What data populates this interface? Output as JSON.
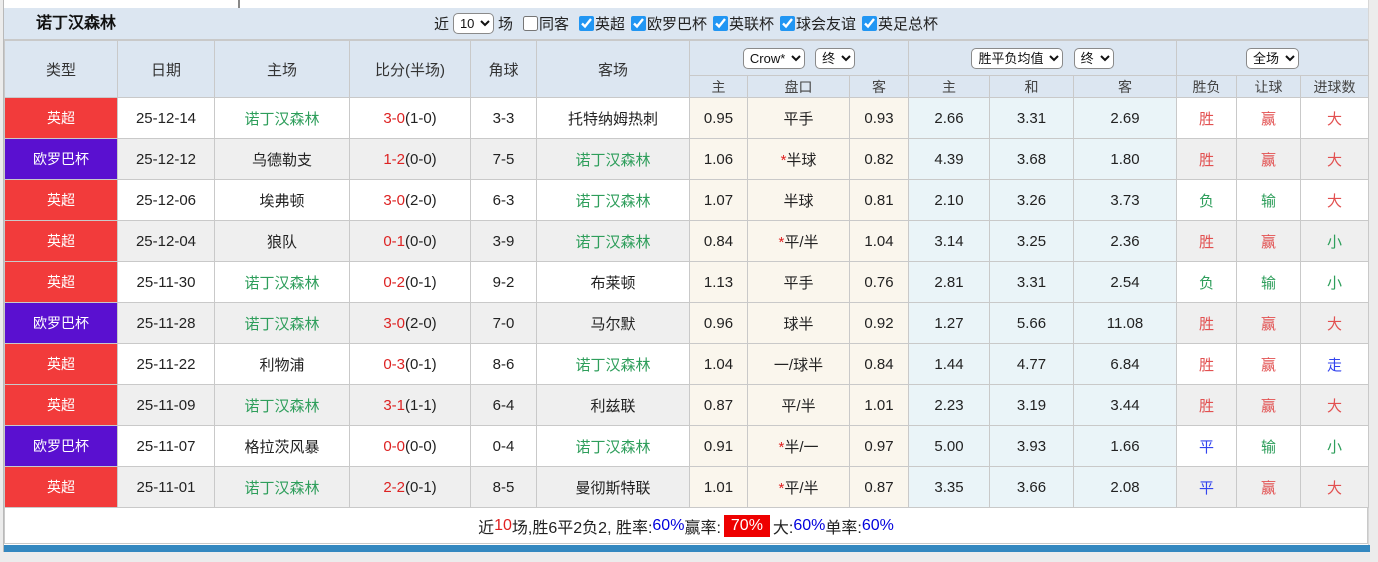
{
  "page": {
    "title": "诺丁汉森林",
    "filter": {
      "recent_prefix": "近",
      "recent_value": "10",
      "recent_suffix": "场",
      "same_away_label": "同客",
      "same_away_checked": false,
      "leagues": [
        {
          "label": "英超",
          "checked": true
        },
        {
          "label": "欧罗巴杯",
          "checked": true
        },
        {
          "label": "英联杯",
          "checked": true
        },
        {
          "label": "球会友谊",
          "checked": true
        },
        {
          "label": "英足总杯",
          "checked": true
        }
      ]
    }
  },
  "table": {
    "columns": [
      "类型",
      "日期",
      "主场",
      "比分(半场)",
      "角球",
      "客场"
    ],
    "groups": {
      "handicap": {
        "company_select": "Crow*",
        "time_select": "终",
        "sub": [
          "主",
          "盘口",
          "客"
        ]
      },
      "europe": {
        "company_select": "胜平负均值",
        "time_select": "终",
        "sub": [
          "主",
          "和",
          "客"
        ]
      },
      "result": {
        "scope_select": "全场",
        "sub": [
          "胜负",
          "让球",
          "进球数"
        ]
      }
    },
    "rows": [
      {
        "league": "英超",
        "league_color": "red",
        "date": "25-12-14",
        "home": "诺丁汉森林",
        "home_self": true,
        "score": "3-0",
        "half": "(1-0)",
        "corner": "3-3",
        "away": "托特纳姆热刺",
        "away_self": false,
        "hcap_home": "0.95",
        "hcap_star": false,
        "hcap_line": "平手",
        "hcap_away": "0.93",
        "euro": [
          "2.66",
          "3.31",
          "2.69"
        ],
        "results": [
          [
            "胜",
            "red"
          ],
          [
            "赢",
            "red"
          ],
          [
            "大",
            "red"
          ]
        ]
      },
      {
        "league": "欧罗巴杯",
        "league_color": "purple",
        "date": "25-12-12",
        "home": "乌德勒支",
        "home_self": false,
        "score": "1-2",
        "half": "(0-0)",
        "corner": "7-5",
        "away": "诺丁汉森林",
        "away_self": true,
        "hcap_home": "1.06",
        "hcap_star": true,
        "hcap_line": "半球",
        "hcap_away": "0.82",
        "euro": [
          "4.39",
          "3.68",
          "1.80"
        ],
        "results": [
          [
            "胜",
            "red"
          ],
          [
            "赢",
            "red"
          ],
          [
            "大",
            "red"
          ]
        ]
      },
      {
        "league": "英超",
        "league_color": "red",
        "date": "25-12-06",
        "home": "埃弗顿",
        "home_self": false,
        "score": "3-0",
        "half": "(2-0)",
        "corner": "6-3",
        "away": "诺丁汉森林",
        "away_self": true,
        "hcap_home": "1.07",
        "hcap_star": false,
        "hcap_line": "半球",
        "hcap_away": "0.81",
        "euro": [
          "2.10",
          "3.26",
          "3.73"
        ],
        "results": [
          [
            "负",
            "green"
          ],
          [
            "输",
            "green"
          ],
          [
            "大",
            "red"
          ]
        ]
      },
      {
        "league": "英超",
        "league_color": "red",
        "date": "25-12-04",
        "home": "狼队",
        "home_self": false,
        "score": "0-1",
        "half": "(0-0)",
        "corner": "3-9",
        "away": "诺丁汉森林",
        "away_self": true,
        "hcap_home": "0.84",
        "hcap_star": true,
        "hcap_line": "平/半",
        "hcap_away": "1.04",
        "euro": [
          "3.14",
          "3.25",
          "2.36"
        ],
        "results": [
          [
            "胜",
            "red"
          ],
          [
            "赢",
            "red"
          ],
          [
            "小",
            "green"
          ]
        ]
      },
      {
        "league": "英超",
        "league_color": "red",
        "date": "25-11-30",
        "home": "诺丁汉森林",
        "home_self": true,
        "score": "0-2",
        "half": "(0-1)",
        "corner": "9-2",
        "away": "布莱顿",
        "away_self": false,
        "hcap_home": "1.13",
        "hcap_star": false,
        "hcap_line": "平手",
        "hcap_away": "0.76",
        "euro": [
          "2.81",
          "3.31",
          "2.54"
        ],
        "results": [
          [
            "负",
            "green"
          ],
          [
            "输",
            "green"
          ],
          [
            "小",
            "green"
          ]
        ]
      },
      {
        "league": "欧罗巴杯",
        "league_color": "purple",
        "date": "25-11-28",
        "home": "诺丁汉森林",
        "home_self": true,
        "score": "3-0",
        "half": "(2-0)",
        "corner": "7-0",
        "away": "马尔默",
        "away_self": false,
        "hcap_home": "0.96",
        "hcap_star": false,
        "hcap_line": "球半",
        "hcap_away": "0.92",
        "euro": [
          "1.27",
          "5.66",
          "11.08"
        ],
        "results": [
          [
            "胜",
            "red"
          ],
          [
            "赢",
            "red"
          ],
          [
            "大",
            "red"
          ]
        ]
      },
      {
        "league": "英超",
        "league_color": "red",
        "date": "25-11-22",
        "home": "利物浦",
        "home_self": false,
        "score": "0-3",
        "half": "(0-1)",
        "corner": "8-6",
        "away": "诺丁汉森林",
        "away_self": true,
        "hcap_home": "1.04",
        "hcap_star": false,
        "hcap_line": "一/球半",
        "hcap_away": "0.84",
        "euro": [
          "1.44",
          "4.77",
          "6.84"
        ],
        "results": [
          [
            "胜",
            "red"
          ],
          [
            "赢",
            "red"
          ],
          [
            "走",
            "blue"
          ]
        ]
      },
      {
        "league": "英超",
        "league_color": "red",
        "date": "25-11-09",
        "home": "诺丁汉森林",
        "home_self": true,
        "score": "3-1",
        "half": "(1-1)",
        "corner": "6-4",
        "away": "利兹联",
        "away_self": false,
        "hcap_home": "0.87",
        "hcap_star": false,
        "hcap_line": "平/半",
        "hcap_away": "1.01",
        "euro": [
          "2.23",
          "3.19",
          "3.44"
        ],
        "results": [
          [
            "胜",
            "red"
          ],
          [
            "赢",
            "red"
          ],
          [
            "大",
            "red"
          ]
        ]
      },
      {
        "league": "欧罗巴杯",
        "league_color": "purple",
        "date": "25-11-07",
        "home": "格拉茨风暴",
        "home_self": false,
        "score": "0-0",
        "half": "(0-0)",
        "corner": "0-4",
        "away": "诺丁汉森林",
        "away_self": true,
        "hcap_home": "0.91",
        "hcap_star": true,
        "hcap_line": "半/一",
        "hcap_away": "0.97",
        "euro": [
          "5.00",
          "3.93",
          "1.66"
        ],
        "results": [
          [
            "平",
            "blue"
          ],
          [
            "输",
            "green"
          ],
          [
            "小",
            "green"
          ]
        ]
      },
      {
        "league": "英超",
        "league_color": "red",
        "date": "25-11-01",
        "home": "诺丁汉森林",
        "home_self": true,
        "score": "2-2",
        "half": "(0-1)",
        "corner": "8-5",
        "away": "曼彻斯特联",
        "away_self": false,
        "hcap_home": "1.01",
        "hcap_star": true,
        "hcap_line": "平/半",
        "hcap_away": "0.87",
        "euro": [
          "3.35",
          "3.66",
          "2.08"
        ],
        "results": [
          [
            "平",
            "blue"
          ],
          [
            "赢",
            "red"
          ],
          [
            "大",
            "red"
          ]
        ]
      }
    ]
  },
  "footer": {
    "parts": [
      {
        "t": "近",
        "c": "black"
      },
      {
        "t": "10",
        "c": "red"
      },
      {
        "t": "场,胜6平2负2, 胜率:",
        "c": "black"
      },
      {
        "t": "60%",
        "c": "blue"
      },
      {
        "t": " 赢率:",
        "c": "black"
      },
      {
        "t": "70%",
        "c": "badge"
      },
      {
        "t": " 大:",
        "c": "black"
      },
      {
        "t": "60%",
        "c": "blue"
      },
      {
        "t": " 单率:",
        "c": "black"
      },
      {
        "t": "60%",
        "c": "blue"
      }
    ]
  },
  "colors": {
    "league_red": "#f23b3b",
    "league_purple": "#5a10d0",
    "self_team_green": "#2e9e5b",
    "score_red": "#dd2222",
    "result_red": "#e25050",
    "result_green": "#2e9e5b",
    "result_blue": "#3344ee",
    "percent_blue": "#0000dd",
    "win_rate_badge_bg": "#ee0000",
    "header_bg": "#dce6f1",
    "handicap_col_bg": "#faf6ed",
    "europe_col_bg": "#eaf4f8",
    "alt_row_bg": "#efefef",
    "bottom_bar_blue": "#3488c0"
  }
}
